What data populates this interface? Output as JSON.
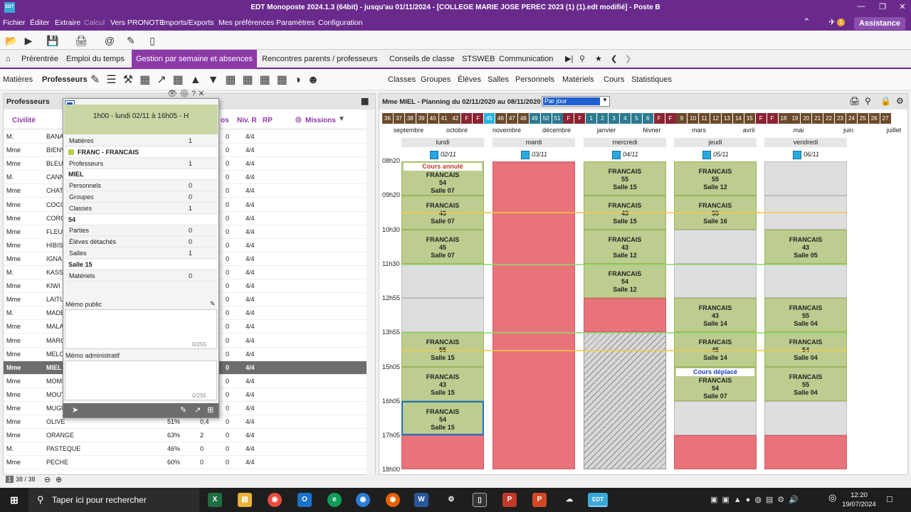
{
  "window": {
    "title": "EDT Monoposte 2024.1.3 (64bit) - jusqu'au 01/11/2024 - [COLLEGE MARIE JOSE PEREC 2023 (1) (1).edt modifié] - Poste B",
    "logo": "EDT"
  },
  "menu": [
    "Fichier",
    "Éditer",
    "Extraire",
    "Calcul",
    "Vers PRONOTE",
    "Imports/Exports",
    "Mes préférences",
    "Paramètres",
    "Configuration"
  ],
  "assistance": "Assistance",
  "notif_count": "1",
  "tabs": [
    "Prérentrée",
    "Emploi du temps",
    "Gestion par semaine et absences",
    "Rencontres parents / professeurs",
    "Conseils de classe",
    "STSWEB",
    "Communication"
  ],
  "subtabs": {
    "left": [
      "Matières",
      "Professeurs"
    ],
    "right": [
      "Classes",
      "Groupes",
      "Élèves",
      "Salles",
      "Personnels",
      "Matériels",
      "Cours",
      "Statistiques"
    ]
  },
  "left": {
    "title": "Professeurs",
    "cols": {
      "civilite": "Civilité",
      "pos": "os",
      "niv": "Niv. R",
      "rp": "RP",
      "missions": "Missions"
    },
    "rows": [
      [
        "M.",
        "BANA",
        "",
        "",
        "0",
        "4/4"
      ],
      [
        "Mme",
        "BIENV",
        "",
        "",
        "0",
        "4/4"
      ],
      [
        "Mme",
        "BLEU",
        "",
        "",
        "0",
        "4/4"
      ],
      [
        "M.",
        "CANN",
        "",
        "",
        "0",
        "4/4"
      ],
      [
        "Mme",
        "CHAT",
        "",
        "",
        "0",
        "4/4"
      ],
      [
        "Mme",
        "COCC",
        "",
        "",
        "0",
        "4/4"
      ],
      [
        "Mme",
        "CORO",
        "",
        "",
        "0",
        "4/4"
      ],
      [
        "Mme",
        "FLEUI",
        "",
        "",
        "0",
        "4/4"
      ],
      [
        "Mme",
        "HIBIS",
        "",
        "",
        "0",
        "4/4"
      ],
      [
        "Mme",
        "IGNA",
        "",
        "",
        "0",
        "4/4"
      ],
      [
        "M.",
        "KASS",
        "",
        "",
        "0",
        "4/4"
      ],
      [
        "Mme",
        "KIWI",
        "",
        "",
        "0",
        "4/4"
      ],
      [
        "Mme",
        "LAITU",
        "",
        "",
        "0",
        "4/4"
      ],
      [
        "M.",
        "MADE",
        "",
        "",
        "0",
        "4/4"
      ],
      [
        "Mme",
        "MALA",
        "",
        "",
        "0",
        "4/4"
      ],
      [
        "Mme",
        "MARC",
        "",
        "",
        "0",
        "4/4"
      ],
      [
        "Mme",
        "MELO",
        "",
        "",
        "0",
        "4/4"
      ],
      [
        "Mme",
        "MIEL",
        "",
        "",
        "0",
        "4/4"
      ],
      [
        "Mme",
        "MOME",
        "",
        "",
        "0",
        "4/4"
      ],
      [
        "Mme",
        "MOUT",
        "",
        "",
        "0",
        "4/4"
      ],
      [
        "Mme",
        "MUGU",
        "",
        "",
        "0",
        "4/4"
      ],
      [
        "Mme",
        "OLIVE",
        "51%",
        "0,4",
        "0",
        "4/4"
      ],
      [
        "Mme",
        "ORANGE",
        "63%",
        "2",
        "0",
        "4/4"
      ],
      [
        "M.",
        "PASTEQUE",
        "46%",
        "0",
        "0",
        "4/4"
      ],
      [
        "Mme",
        "PECHE",
        "60%",
        "0",
        "0",
        "4/4"
      ]
    ],
    "count": "38 / 38"
  },
  "popup": {
    "header": "1h00 - lundi 02/11 à 16h05 - H",
    "rows": [
      {
        "label": "Matières",
        "val": "1"
      },
      {
        "label": "FRANC - FRANCAIS",
        "val": "",
        "white": true,
        "bold": true
      },
      {
        "label": "Professeurs",
        "val": "1"
      },
      {
        "label": "MIEL",
        "val": "",
        "white": true,
        "bold": true
      },
      {
        "label": "Personnels",
        "val": "0"
      },
      {
        "label": "Groupes",
        "val": "0"
      },
      {
        "label": "Classes",
        "val": "1"
      },
      {
        "label": "54",
        "val": "",
        "white": true,
        "bold": true
      },
      {
        "label": "Parties",
        "val": "0"
      },
      {
        "label": "Élèves détachés",
        "val": "0"
      },
      {
        "label": "Salles",
        "val": "1"
      },
      {
        "label": "Salle 15",
        "val": "",
        "white": true,
        "bold": true
      },
      {
        "label": "Matériels",
        "val": "0"
      }
    ],
    "memo_public": "Mémo public",
    "memo_admin": "Mémo administratif",
    "counter": "0/255"
  },
  "right": {
    "title": "Mme MIEL - Planning du 02/11/2020 au 08/11/2020",
    "view": "Par jour",
    "weeks": [
      "36",
      "37",
      "38",
      "39",
      "40",
      "41",
      "42",
      "F",
      "F",
      "45",
      "46",
      "47",
      "48",
      "49",
      "50",
      "51",
      "F",
      "F",
      "1",
      "2",
      "3",
      "4",
      "5",
      "6",
      "F",
      "F",
      "9",
      "10",
      "11",
      "12",
      "13",
      "14",
      "15",
      "F",
      "F",
      "18",
      "19",
      "20",
      "21",
      "22",
      "23",
      "24",
      "25",
      "26",
      "27"
    ],
    "months": [
      "septembre",
      "octobre",
      "novembre",
      "décembre",
      "janvier",
      "février",
      "mars",
      "avril",
      "mai",
      "juin",
      "juillet"
    ],
    "days": [
      "lundi",
      "mardi",
      "mercredi",
      "jeudi",
      "vendredi"
    ],
    "dates": [
      "02/11",
      "03/11",
      "04/11",
      "05/11",
      "06/11"
    ],
    "times": [
      "08h20",
      "09h20",
      "10h30",
      "11h30",
      "12h55",
      "13h55",
      "15h05",
      "16h05",
      "17h05",
      "18h00"
    ]
  },
  "courses": {
    "mon": [
      {
        "note": "Cours annulé",
        "s": "FRANCAIS",
        "c": "54",
        "r": "Salle 07"
      },
      {
        "s": "FRANCAIS",
        "c": "45",
        "r": "Salle 07"
      },
      {
        "s": "FRANCAIS",
        "c": "45",
        "r": "Salle 07"
      },
      {
        "s": "FRANCAIS",
        "c": "55",
        "r": "Salle 15"
      },
      {
        "s": "FRANCAIS",
        "c": "43",
        "r": "Salle 15"
      },
      {
        "s": "FRANCAIS",
        "c": "54",
        "r": "Salle 15"
      }
    ],
    "wed": [
      {
        "s": "FRANCAIS",
        "c": "55",
        "r": "Salle 15"
      },
      {
        "s": "FRANCAIS",
        "c": "43",
        "r": "Salle 15"
      },
      {
        "s": "FRANCAIS",
        "c": "43",
        "r": "Salle 12"
      },
      {
        "s": "FRANCAIS",
        "c": "54",
        "r": "Salle 12"
      }
    ],
    "thu": [
      {
        "s": "FRANCAIS",
        "c": "55",
        "r": "Salle 12"
      },
      {
        "s": "FRANCAIS",
        "c": "55",
        "r": "Salle 16"
      },
      {
        "s": "FRANCAIS",
        "c": "43",
        "r": "Salle 14"
      },
      {
        "s": "FRANCAIS",
        "c": "45",
        "r": "Salle 14"
      },
      {
        "note": "Cours déplacé",
        "s": "FRANCAIS",
        "c": "54",
        "r": "Salle 07"
      }
    ],
    "fri": [
      {
        "s": "FRANCAIS",
        "c": "43",
        "r": "Salle 05"
      },
      {
        "s": "FRANCAIS",
        "c": "55",
        "r": "Salle 04"
      },
      {
        "s": "FRANCAIS",
        "c": "54",
        "r": "Salle 04"
      },
      {
        "s": "FRANCAIS",
        "c": "55",
        "r": "Salle 04"
      }
    ]
  },
  "taskbar": {
    "search": "Taper ici pour rechercher",
    "time": "12:20",
    "date": "19/07/2024"
  }
}
